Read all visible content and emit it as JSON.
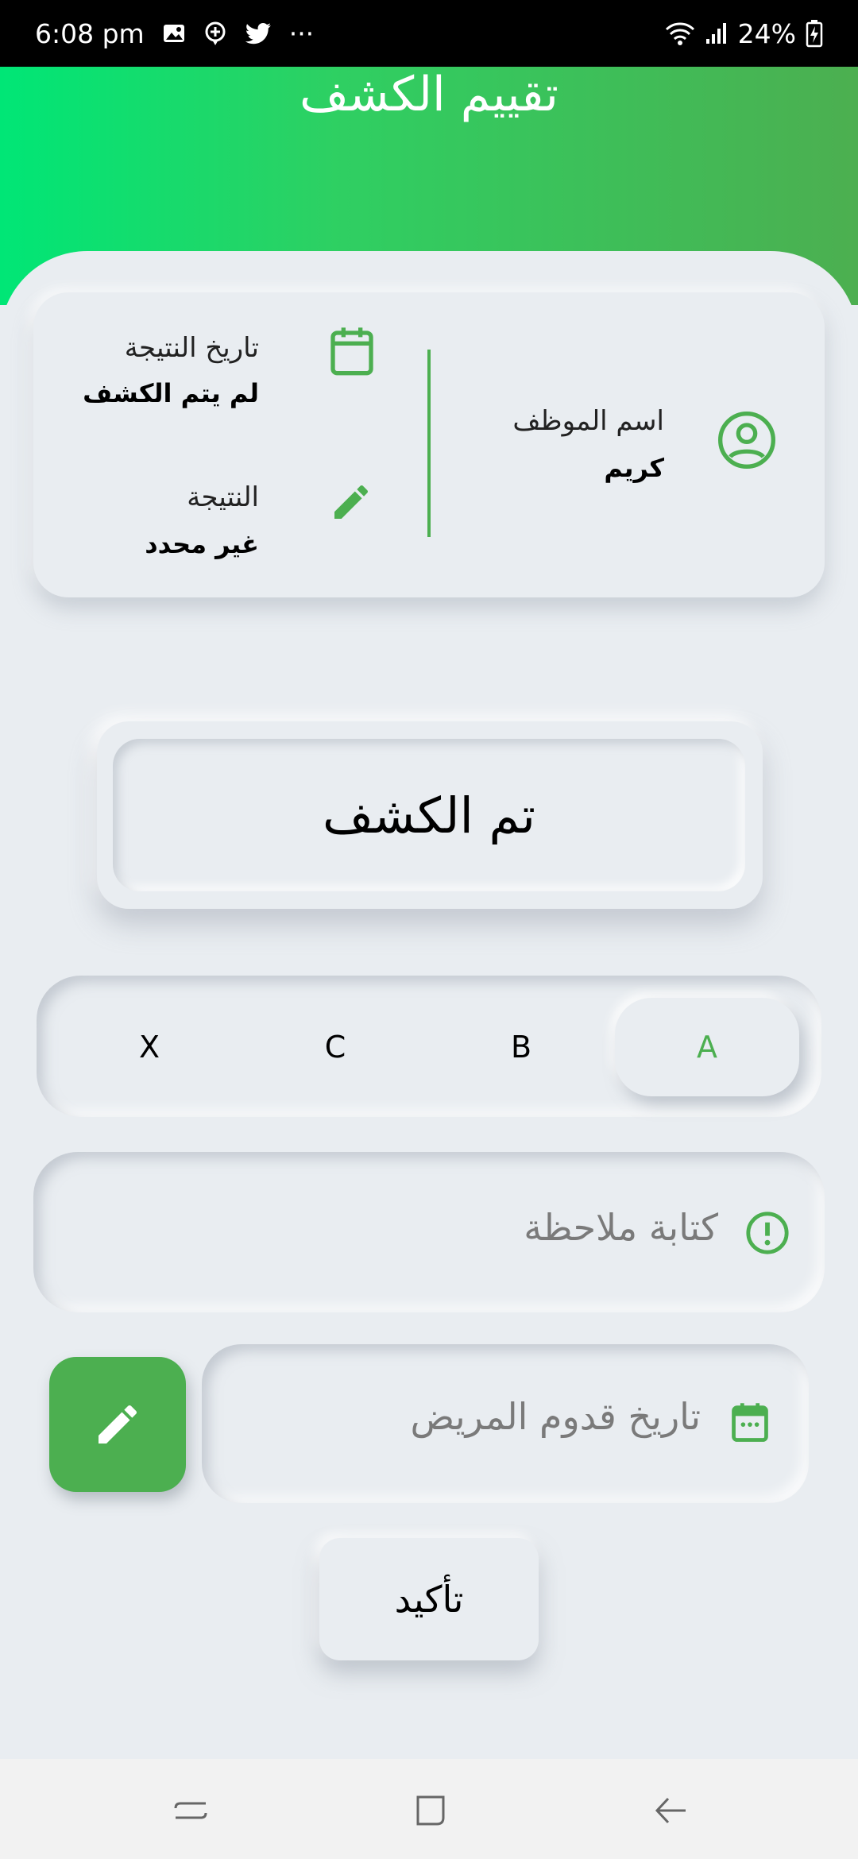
{
  "status_bar": {
    "time": "6:08 pm",
    "battery": "24%",
    "more": "···"
  },
  "header": {
    "title": "تقييم الكشف"
  },
  "info_card": {
    "employee_label": "اسم الموظف",
    "employee_value": "كريم",
    "result_date_label": "تاريخ النتيجة",
    "result_date_value": "لم يتم الكشف",
    "result_label": "النتيجة",
    "result_value": "غير محدد"
  },
  "done_button": {
    "label": "تم الكشف"
  },
  "segment": {
    "options": [
      "A",
      "B",
      "C",
      "X"
    ],
    "selected": "A"
  },
  "note": {
    "placeholder": "كتابة ملاحظة"
  },
  "date_field": {
    "placeholder": "تاريخ قدوم المريض"
  },
  "confirm": {
    "label": "تأكيد"
  },
  "colors": {
    "accent": "#4caf50",
    "header_start": "#00e676",
    "background": "#e9edf1"
  },
  "icons": {
    "employee": "account-circle-icon",
    "result_date": "calendar-icon",
    "result": "pencil-icon",
    "note": "alert-circle-icon",
    "date_field": "calendar-month-icon",
    "edit_button": "pencil-icon"
  }
}
